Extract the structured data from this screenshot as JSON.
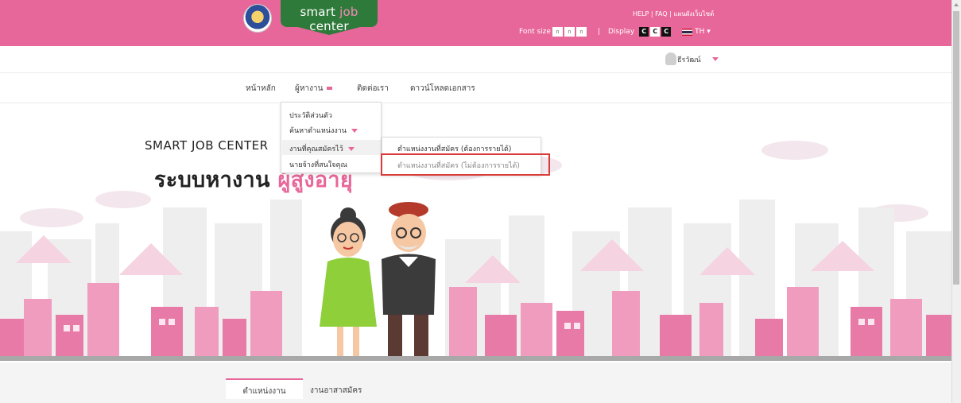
{
  "header": {
    "logo_text_a": "smart ",
    "logo_text_b": "job",
    "logo_text_c": " center",
    "help_links": "HELP | FAQ | แผนผังเว็บไซต์",
    "font_size_label": "Font size",
    "font_options": [
      "ก",
      "ก",
      "ก"
    ],
    "divider": "|",
    "display_label": "Display",
    "display_options": [
      "C",
      "C",
      "C"
    ],
    "language": "TH ▾",
    "accent_color": "#e8679a"
  },
  "user": {
    "name": "ธีรวัฒน์"
  },
  "nav": {
    "home": "หน้าหลัก",
    "job_seeker": "ผู้หางาน",
    "contact": "ติดต่อเรา",
    "download": "ดาวน์โหลดเอกสาร"
  },
  "dropdown": {
    "profile": "ประวัติส่วนตัว",
    "search_jobs": "ค้นหาตำแหน่งงาน",
    "applied_jobs": "งานที่คุณสมัครไว้",
    "interested_employers": "นายจ้างที่สนใจคุณ"
  },
  "submenu": {
    "need_income": "ตำแหน่งงานที่สมัคร (ต้องการรายได้)",
    "no_income": "ตำแหน่งงานที่สมัคร (ไม่ต้องการรายได้)"
  },
  "hero": {
    "title_en": "SMART JOB CENTER",
    "title_th": "ระบบหางาน ",
    "title_th_highlight": "ผู้สูงอายุ"
  },
  "tabs": {
    "positions": "ตำแหน่งงาน",
    "volunteer": "งานอาสาสมัคร"
  }
}
